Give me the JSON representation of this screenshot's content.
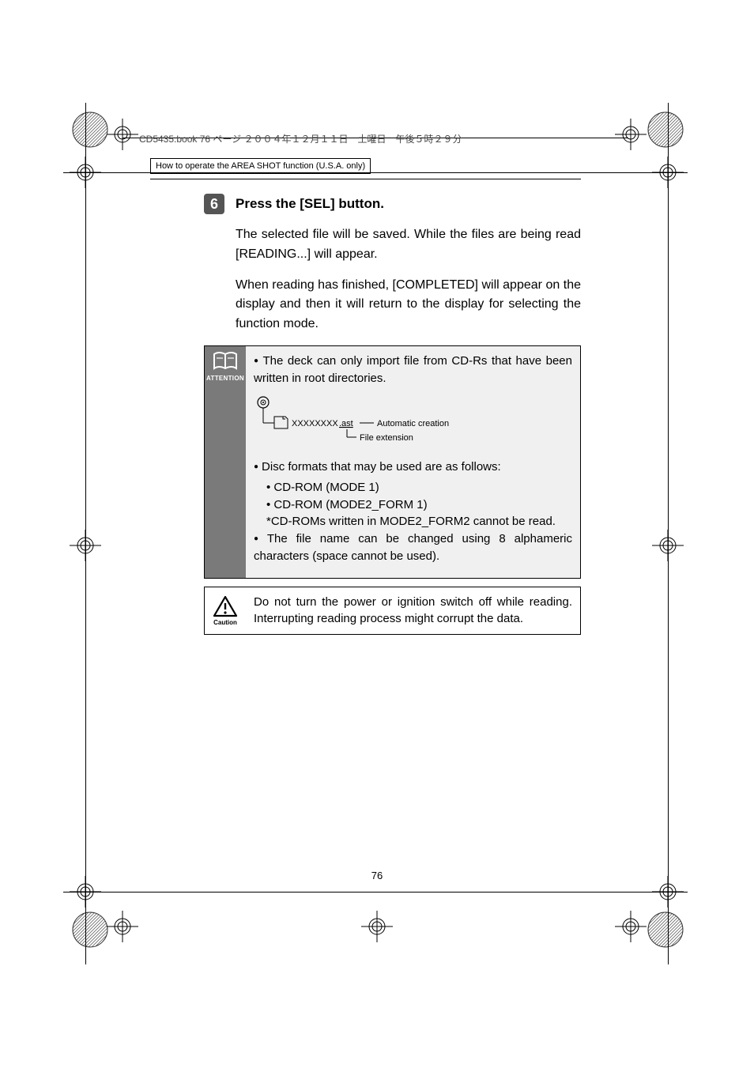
{
  "header_line": "CD5435.book  76 ページ  ２００４年１２月１１日　土曜日　午後５時２９分",
  "section_header": "How to operate the AREA SHOT function (U.S.A. only)",
  "step": {
    "number": "6",
    "title": "Press the [SEL] button."
  },
  "body_paragraphs": [
    "The selected file will be saved. While the files are being read [READING...] will appear.",
    "When reading has finished, [COMPLETED] will appear on the display and then it will return to the display for selecting the function mode."
  ],
  "attention": {
    "label": "ATTENTION",
    "items": [
      "The deck can only import file from CD-Rs that have been written in root directories.",
      "Disc formats that may be used are as follows:",
      "The file name can be changed using 8 alphameric characters (space cannot be used)."
    ],
    "disc_formats": [
      "CD-ROM (MODE 1)",
      "CD-ROM (MODE2_FORM 1)",
      "*CD-ROMs written in MODE2_FORM2 cannot be read."
    ],
    "diagram": {
      "filename": "XXXXXXXX.ast",
      "right_label": "Automatic creation",
      "ext_label": "File extension"
    }
  },
  "caution": {
    "label": "Caution",
    "text": "Do not turn the power or ignition switch off while reading. Interrupting reading process might corrupt the data."
  },
  "page_number": "76"
}
